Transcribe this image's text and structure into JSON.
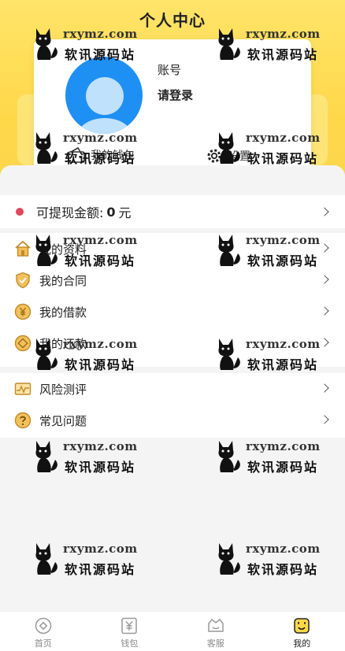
{
  "header": {
    "title": "个人中心"
  },
  "profile": {
    "account_label": "账号",
    "login_text": "请登录",
    "wallet_label": "我的钱包",
    "settings_label": "设置"
  },
  "balance": {
    "label": "可提现金额:",
    "amount": "0",
    "unit": "元"
  },
  "menu": {
    "group1": [
      {
        "label": "我的资料",
        "icon": "home-icon"
      },
      {
        "label": "我的合同",
        "icon": "shield-icon"
      },
      {
        "label": "我的借款",
        "icon": "yen-coin-icon"
      },
      {
        "label": "我的还款",
        "icon": "repay-coin-icon"
      }
    ],
    "group2": [
      {
        "label": "风险测评",
        "icon": "risk-chart-icon"
      },
      {
        "label": "常见问题",
        "icon": "question-icon"
      }
    ]
  },
  "tabbar": [
    {
      "label": "首页",
      "icon": "home-tab-icon"
    },
    {
      "label": "钱包",
      "icon": "wallet-tab-icon"
    },
    {
      "label": "客服",
      "icon": "service-tab-icon"
    },
    {
      "label": "我的",
      "icon": "profile-tab-icon",
      "active": true
    }
  ],
  "watermark": {
    "url": "rxymz.com",
    "text": "软讯源码站"
  },
  "colors": {
    "brand_yellow": "#ffd84a",
    "avatar_blue": "#1e90f4",
    "balance_dot": "#e5465a"
  }
}
